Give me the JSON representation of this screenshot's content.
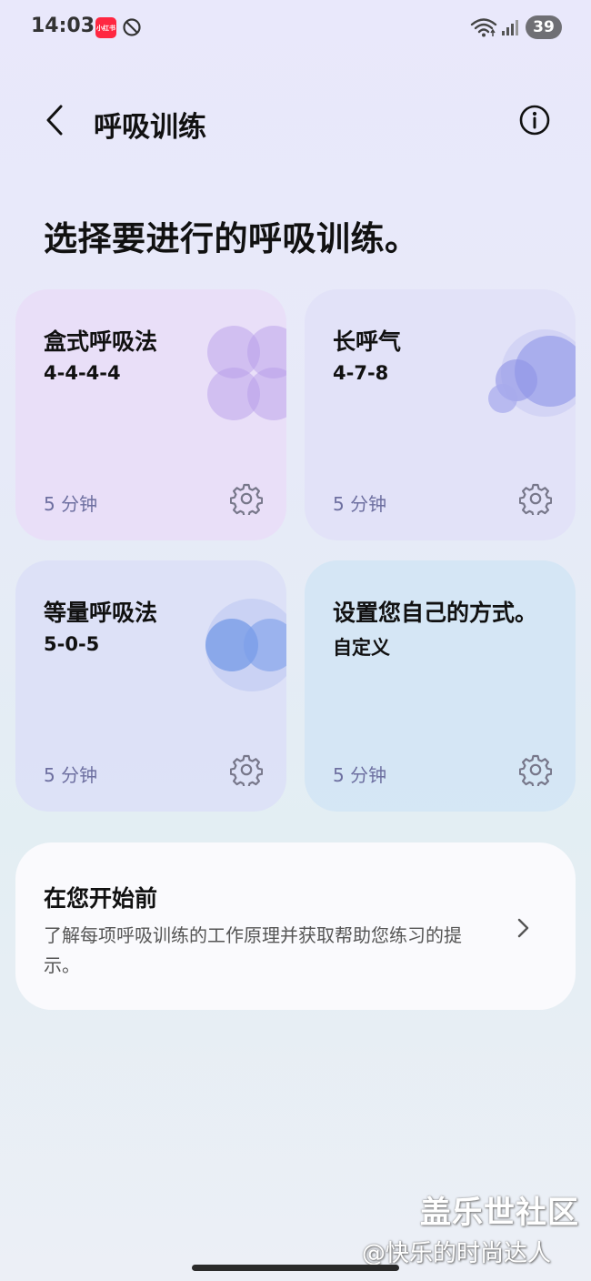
{
  "status_bar": {
    "time": "14:03",
    "app_badge": "小红书",
    "battery": "39",
    "icons": [
      "xiaohongshu-app-icon",
      "do-not-disturb-icon",
      "wifi-icon",
      "signal-icon",
      "battery-icon"
    ]
  },
  "header": {
    "title": "呼吸训练",
    "back_icon": "chevron-left-icon",
    "info_icon": "info-circle-icon"
  },
  "page_heading": "选择要进行的呼吸训练。",
  "cards": [
    {
      "title": "盒式呼吸法",
      "subtitle": "4-4-4-4",
      "duration": "5 分钟",
      "settings_icon": "gear-icon",
      "art": "four-petal-flower",
      "accent": "#b49ae8"
    },
    {
      "title": "长呼气",
      "subtitle": "4-7-8",
      "duration": "5 分钟",
      "settings_icon": "gear-icon",
      "art": "bubbles",
      "accent": "#9f9de8"
    },
    {
      "title": "等量呼吸法",
      "subtitle": "5-0-5",
      "duration": "5 分钟",
      "settings_icon": "gear-icon",
      "art": "overlapping-circles",
      "accent": "#7da2ea"
    },
    {
      "title": "设置您自己的方式。",
      "subtitle": "自定义",
      "duration": "5 分钟",
      "settings_icon": "gear-icon",
      "art": "none",
      "accent": "#9fc3e6"
    }
  ],
  "before_start": {
    "title": "在您开始前",
    "description": "了解每项呼吸训练的工作原理并获取帮助您练习的提示。",
    "chevron_icon": "chevron-right-icon"
  },
  "watermark": {
    "main": "盖乐世社区",
    "handle": "@快乐的时尚达人"
  }
}
